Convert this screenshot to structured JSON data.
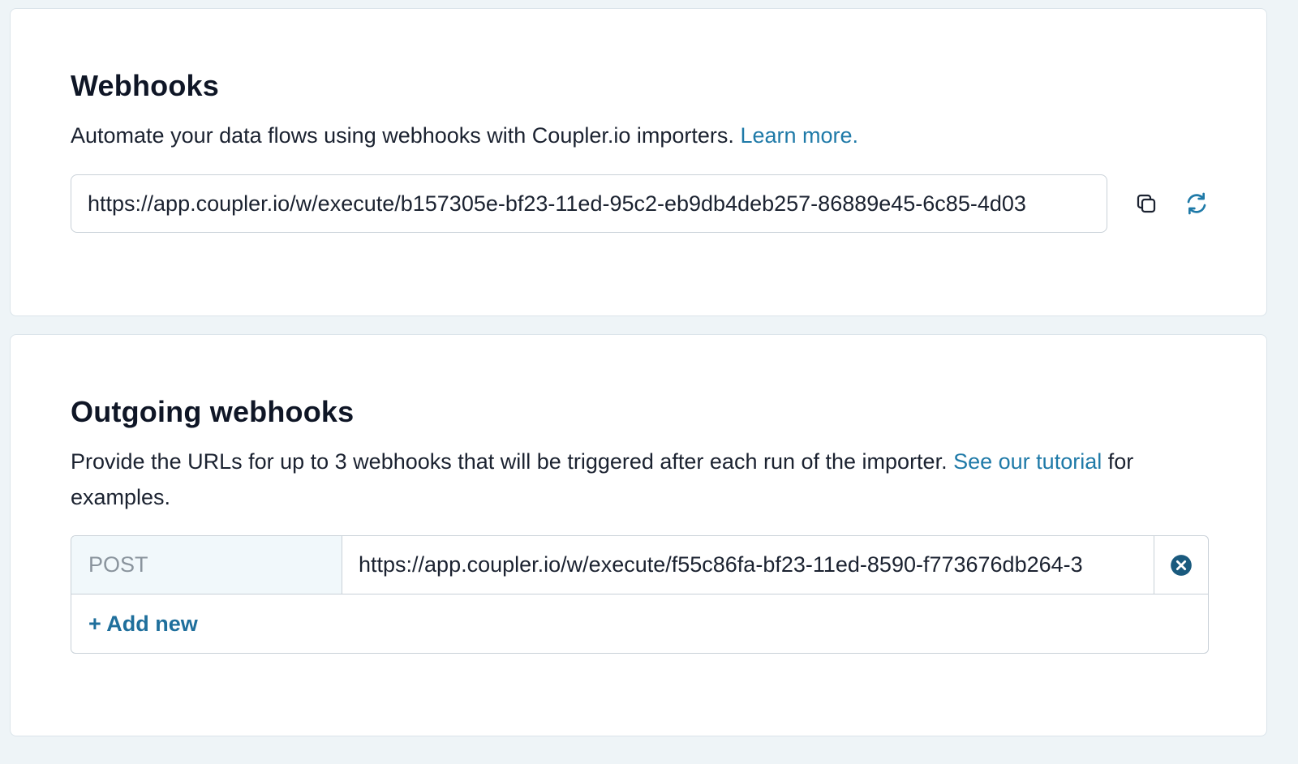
{
  "webhooks": {
    "title": "Webhooks",
    "description": "Automate your data flows using webhooks with Coupler.io importers.",
    "learn_more": "Learn more.",
    "url": "https://app.coupler.io/w/execute/b157305e-bf23-11ed-95c2-eb9db4deb257-86889e45-6c85-4d03",
    "copy_icon": "copy-icon",
    "refresh_icon": "refresh-icon"
  },
  "outgoing": {
    "title": "Outgoing webhooks",
    "description_before": "Provide the URLs for up to 3 webhooks that will be triggered after each run of the importer.",
    "tutorial_link": "See our tutorial",
    "description_after": "for examples.",
    "hooks": [
      {
        "method": "POST",
        "url": "https://app.coupler.io/w/execute/f55c86fa-bf23-11ed-8590-f773676db264-3"
      }
    ],
    "add_new": "+ Add new",
    "remove_icon": "close-circle-icon"
  },
  "colors": {
    "accent": "#1f7aa8",
    "border": "#c9d1d8",
    "method_bg": "#f1f8fb",
    "remove_icon": "#1a5a7e"
  }
}
